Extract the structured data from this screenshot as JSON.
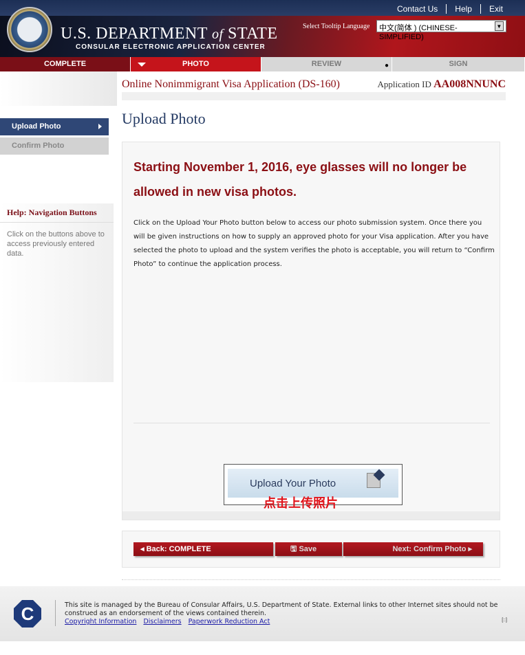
{
  "header": {
    "links": [
      "Contact Us",
      "Help",
      "Exit"
    ],
    "dept_prefix": "U.S. DEPARTMENT ",
    "dept_of": "of",
    "dept_suffix": " STATE",
    "subtitle": "CONSULAR ELECTRONIC APPLICATION CENTER",
    "tooltip_label": "Select Tooltip Language",
    "language": "中文(简体 ) (CHINESE-SIMPLIFIED)"
  },
  "tabs": [
    "COMPLETE",
    "PHOTO",
    "REVIEW",
    "SIGN"
  ],
  "app": {
    "title": "Online Nonimmigrant Visa Application (DS-160)",
    "id_label": "Application ID ",
    "id": "AA008NNUNC"
  },
  "sidebar": {
    "items": [
      "Upload Photo",
      "Confirm Photo"
    ],
    "help_title": "Help: Navigation Buttons",
    "help_text": "Click on the buttons above to access previously entered data."
  },
  "main": {
    "heading": "Upload Photo",
    "warning": "Starting November 1, 2016, eye glasses will no longer be allowed in new visa photos.",
    "body": "Click on the Upload Your Photo button below to access our photo submission system. Once there you will be given instructions on how to supply an approved photo for your Visa application. After you have selected the photo to upload and the system verifies the photo is acceptable, you will return to “Confirm Photo” to continue the application process.",
    "upload_label": "Upload Your Photo",
    "annotation": "点击上传照片"
  },
  "nav": {
    "back": "Back: COMPLETE",
    "save": "Save",
    "next": "Next: Confirm Photo"
  },
  "footer": {
    "text": "This site is managed by the Bureau of Consular Affairs, U.S. Department of State. External links to other Internet sites should not be construed as an endorsement of the views contained therein.",
    "links": [
      "Copyright Information",
      "Disclaimers",
      "Paperwork Reduction Act"
    ],
    "logo": "C",
    "badge": "[::]"
  }
}
